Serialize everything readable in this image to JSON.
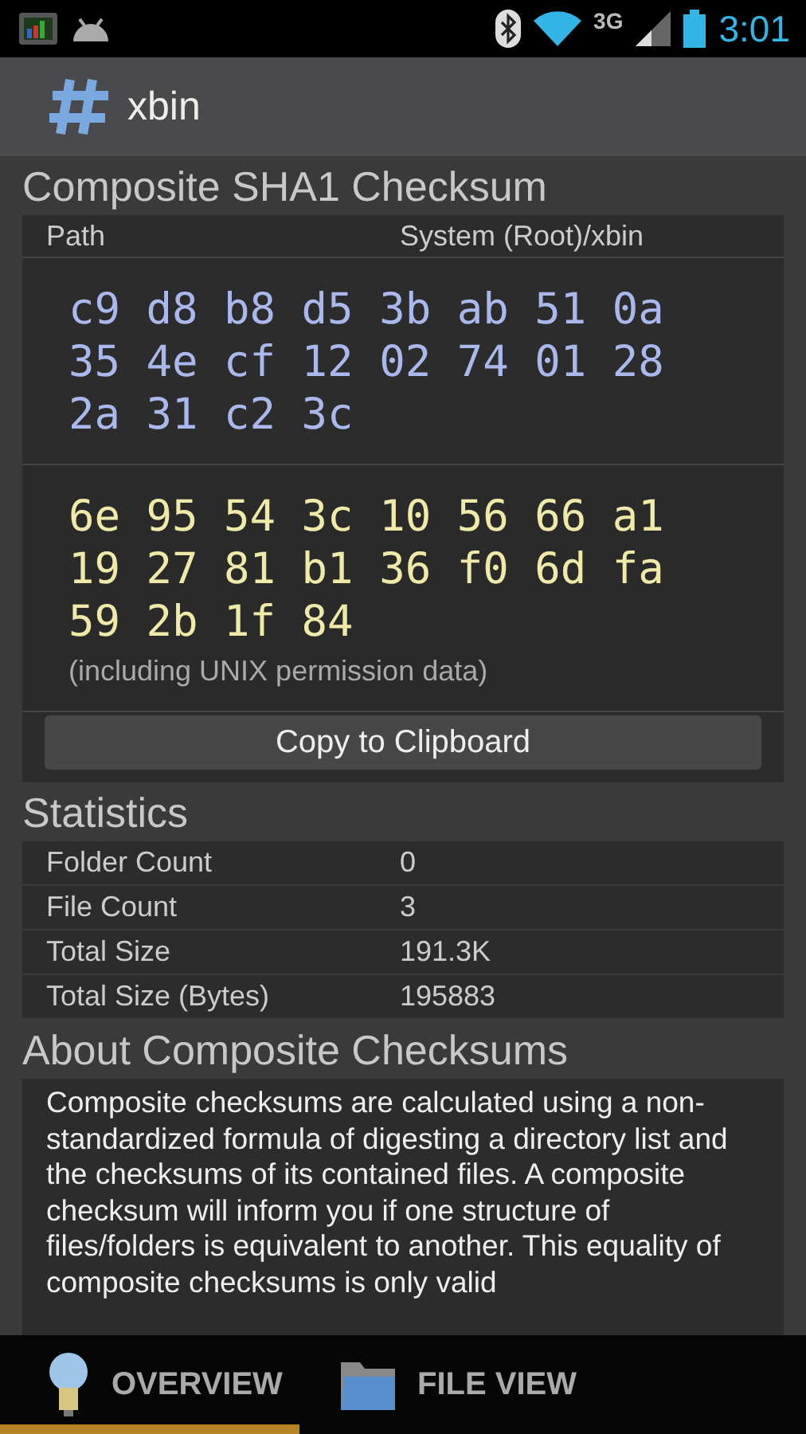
{
  "status_bar": {
    "network": "3G",
    "time": "3:01"
  },
  "action_bar": {
    "title": "xbin"
  },
  "checksum": {
    "title": "Composite SHA1 Checksum",
    "path_label": "Path",
    "path_value": "System (Root)/xbin",
    "hash_plain": [
      "c9 d8 b8 d5 3b ab 51 0a",
      "35 4e cf 12 02 74 01 28",
      "2a 31 c2 3c"
    ],
    "hash_permissions": [
      "6e 95 54 3c 10 56 66 a1",
      "19 27 81 b1 36 f0 6d fa",
      "59 2b 1f 84"
    ],
    "permissions_note": "(including UNIX permission data)",
    "copy_button": "Copy to Clipboard"
  },
  "statistics": {
    "title": "Statistics",
    "rows": [
      {
        "label": "Folder Count",
        "value": "0"
      },
      {
        "label": "File Count",
        "value": "3"
      },
      {
        "label": "Total Size",
        "value": "191.3K"
      },
      {
        "label": "Total Size (Bytes)",
        "value": "195883"
      }
    ]
  },
  "about": {
    "title": "About Composite Checksums",
    "text": "Composite checksums are calculated using a non-standardized formula of digesting a directory list and the checksums of its contained files. A composite checksum will inform you if one structure of files/folders is equivalent to another. This equality of composite checksums is only valid"
  },
  "tabs": [
    {
      "label": "OVERVIEW",
      "kind": "overview",
      "selected": true
    },
    {
      "label": "FILE VIEW",
      "kind": "files",
      "selected": false
    }
  ]
}
